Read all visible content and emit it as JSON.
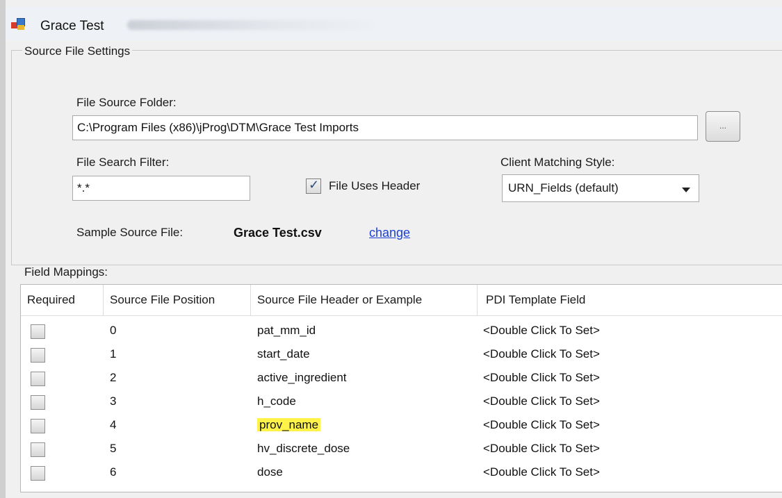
{
  "window": {
    "title": "Grace Test"
  },
  "source_settings": {
    "group_label": "Source File Settings",
    "folder_label": "File Source Folder:",
    "folder_value": "C:\\Program Files (x86)\\jProg\\DTM\\Grace Test Imports",
    "browse_label": "...",
    "filter_label": "File Search Filter:",
    "filter_value": "*.*",
    "uses_header_label": "File Uses Header",
    "uses_header_checked": true,
    "matching_label": "Client Matching Style:",
    "matching_value": "URN_Fields (default)",
    "sample_label": "Sample Source File:",
    "sample_value": "Grace Test.csv",
    "change_link": "change"
  },
  "mappings": {
    "group_label": "Field Mappings:",
    "columns": [
      "Required",
      "Source File Position",
      "Source File Header or Example",
      "PDI Template Field"
    ],
    "rows": [
      {
        "position": "0",
        "header": "pat_mm_id",
        "field": "<Double Click To Set>",
        "highlighted": false
      },
      {
        "position": "1",
        "header": "start_date",
        "field": "<Double Click To Set>",
        "highlighted": false
      },
      {
        "position": "2",
        "header": "active_ingredient",
        "field": "<Double Click To Set>",
        "highlighted": false
      },
      {
        "position": "3",
        "header": "h_code",
        "field": "<Double Click To Set>",
        "highlighted": false
      },
      {
        "position": "4",
        "header": "prov_name",
        "field": "<Double Click To Set>",
        "highlighted": true
      },
      {
        "position": "5",
        "header": "hv_discrete_dose",
        "field": "<Double Click To Set>",
        "highlighted": false
      },
      {
        "position": "6",
        "header": "dose",
        "field": "<Double Click To Set>",
        "highlighted": false
      }
    ]
  },
  "colors": {
    "highlight": "#fff34a",
    "link": "#1a3fd8"
  }
}
